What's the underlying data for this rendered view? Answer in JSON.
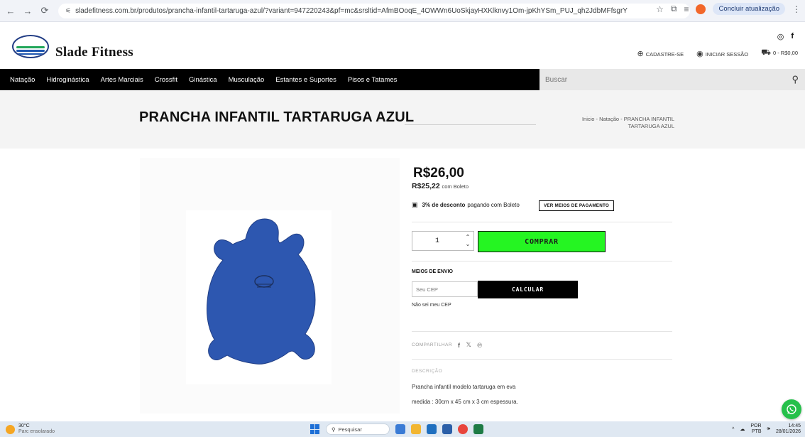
{
  "browser": {
    "url": "sladefitness.com.br/produtos/prancha-infantil-tartaruga-azul/?variant=947220243&pf=mc&srsltid=AfmBOoqE_4OWWn6UoSkjayHXKlknvy1Om-jpKhYSm_PUJ_qh2JdbMFfsgrY",
    "update_button": "Concluir atualização"
  },
  "header": {
    "logo_text": "Slade Fitness",
    "register": "CADASTRE-SE",
    "login": "INICIAR SESSÃO",
    "cart": "0 - R$0,00"
  },
  "nav": {
    "items": [
      "Natação",
      "Hidroginástica",
      "Artes Marciais",
      "Crossfit",
      "Ginástica",
      "Musculação",
      "Estantes e Suportes",
      "Pisos e Tatames"
    ],
    "search_placeholder": "Buscar"
  },
  "product": {
    "title": "PRANCHA INFANTIL TARTARUGA AZUL",
    "breadcrumb": "Inicio - Natação - PRANCHA INFANTIL TARTARUGA AZUL",
    "price": "R$26,00",
    "boleto_price": "R$25,22",
    "boleto_suffix": "com Boleto",
    "discount_bold": "3% de desconto",
    "discount_rest": "pagando com Boleto",
    "payment_button": "VER MEIOS DE PAGAMENTO",
    "quantity": "1",
    "buy_button": "COMPRAR",
    "shipping_title": "MEIOS DE ENVIO",
    "cep_placeholder": "Seu CEP",
    "calc_button": "CALCULAR",
    "cep_link": "Não sei meu CEP",
    "share_label": "COMPARTILHAR",
    "description_label": "DESCRIÇÃO",
    "description_lines": [
      "Prancha infantil modelo tartaruga em eva",
      "medida : 30cm x 45 cm x 3 cm espessura."
    ],
    "board_color": "#2d57b0"
  },
  "taskbar": {
    "weather_temp": "30°C",
    "weather_desc": "Parc ensolarado",
    "search": "Pesquisar",
    "lang_top": "POR",
    "lang_bottom": "PTB",
    "time": "14:45",
    "date": "28/01/2026"
  }
}
